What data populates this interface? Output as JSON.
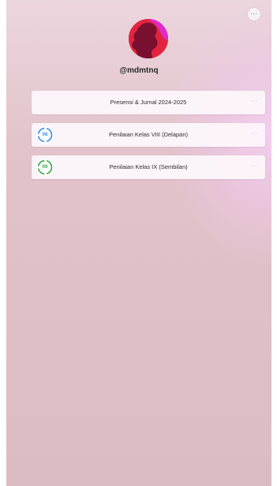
{
  "profile": {
    "username": "@mdmtnq",
    "avatar_colors": {
      "background": "#e3243f",
      "dark": "#7a1030",
      "accent": "#e12acb"
    }
  },
  "header": {
    "menu_icon": "more-dots-icon",
    "menu_label": "···"
  },
  "links": [
    {
      "label": "Presensi & Jurnal 2024-2025",
      "more": "···"
    },
    {
      "label": "Penilaian Kelas VIII (Delapan)",
      "more": "···",
      "badge": "08",
      "badge_color": "#3b8ee6"
    },
    {
      "label": "Penilaian Kelas IX (Sembilan)",
      "more": "···",
      "badge": "09",
      "badge_color": "#3aa64a"
    }
  ]
}
